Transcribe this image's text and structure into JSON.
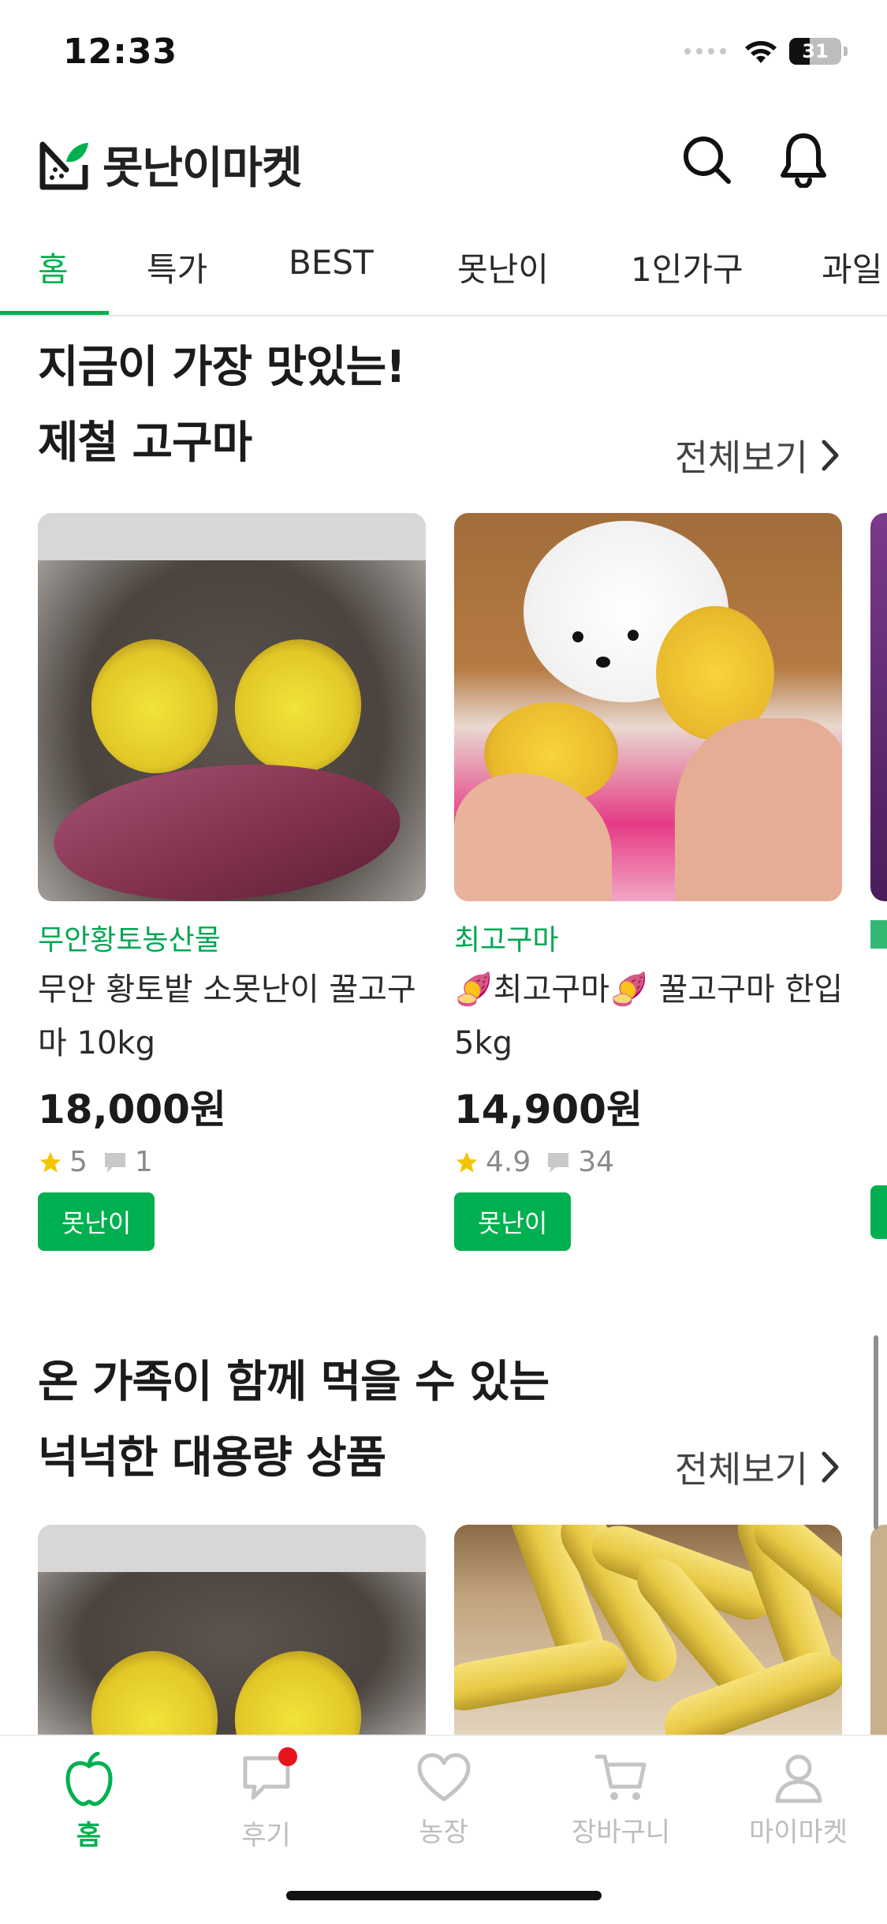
{
  "status_bar": {
    "time": "12:33",
    "battery": "31"
  },
  "header": {
    "app_name": "못난이마켓",
    "search_icon": "search-icon",
    "bell_icon": "bell-icon"
  },
  "tabs": [
    {
      "label": "홈",
      "active": true
    },
    {
      "label": "특가",
      "active": false
    },
    {
      "label": "BEST",
      "active": false
    },
    {
      "label": "못난이",
      "active": false
    },
    {
      "label": "1인가구",
      "active": false
    },
    {
      "label": "과일",
      "active": false
    }
  ],
  "section1": {
    "title_line1": "지금이 가장 맛있는!",
    "title_line2": "제철 고구마",
    "see_all": "전체보기",
    "products": [
      {
        "shop": "무안황토농산물",
        "name": "무안 황토밭 소못난이 꿀고구마 10kg",
        "price": "18,000원",
        "rating": "5",
        "reviews": "1",
        "badge": "못난이"
      },
      {
        "shop": "최고구마",
        "name": "🍠최고구마🍠 꿀고구마 한입 5kg",
        "price": "14,900원",
        "rating": "4.9",
        "reviews": "34",
        "badge": "못난이"
      }
    ]
  },
  "section2": {
    "title_line1": "온 가족이 함께 먹을 수 있는",
    "title_line2": "넉넉한 대용량 상품",
    "see_all": "전체보기"
  },
  "bottom_nav": [
    {
      "label": "홈",
      "icon": "apple-icon",
      "active": true
    },
    {
      "label": "후기",
      "icon": "chat-bubble-icon",
      "active": false,
      "badge_dot": true
    },
    {
      "label": "농장",
      "icon": "heart-icon",
      "active": false
    },
    {
      "label": "장바구니",
      "icon": "cart-icon",
      "active": false
    },
    {
      "label": "마이마켓",
      "icon": "person-icon",
      "active": false
    }
  ],
  "colors": {
    "accent": "#00b050",
    "badge_bg": "#00b050",
    "star": "#f5c400",
    "notify_dot": "#e8141b"
  }
}
